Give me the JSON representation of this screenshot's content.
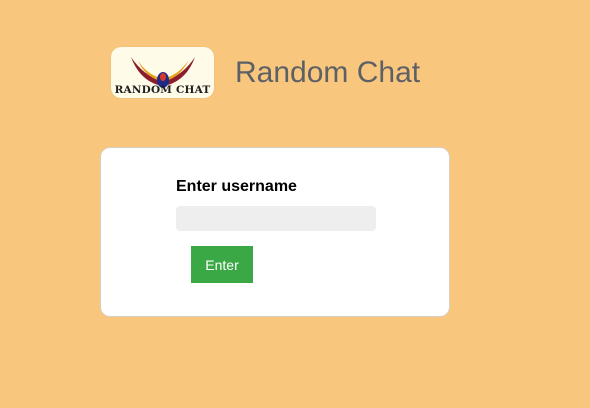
{
  "header": {
    "title": "Random Chat",
    "logo_text": "RANDOM CHAT",
    "logo_icon": "bird-logo"
  },
  "login": {
    "label": "Enter username",
    "input_value": "",
    "input_placeholder": "",
    "button_label": "Enter"
  },
  "colors": {
    "page_background": "#f9c67d",
    "card_background": "#ffffff",
    "input_background": "#eeeeee",
    "button_background": "#3aa845",
    "title_text": "#5d6166"
  }
}
